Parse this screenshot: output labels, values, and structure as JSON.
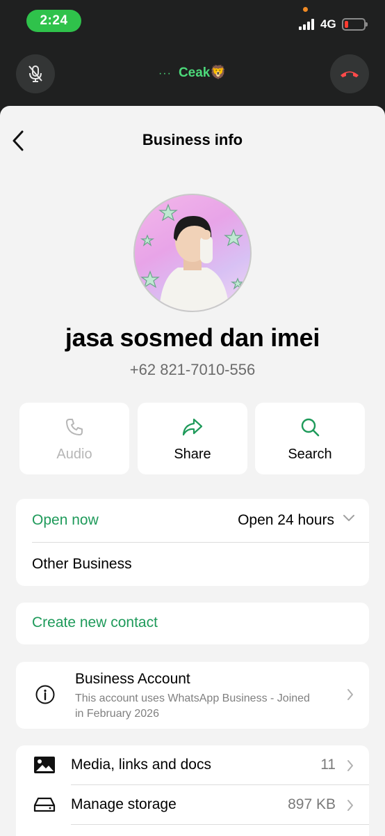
{
  "status_bar": {
    "time": "2:24",
    "network": "4G",
    "battery_level": 0.2,
    "time_pill_color": "#2fc24b"
  },
  "call_bar": {
    "dots": "···",
    "caller": "Ceak🦁",
    "mute_icon": "mic-off-icon",
    "end_icon": "phone-end-icon",
    "accent_color": "#4cd97a",
    "end_color": "#ff4a4a"
  },
  "header": {
    "title": "Business info",
    "back_icon": "chevron-left-icon"
  },
  "profile": {
    "name": "jasa sosmed dan imei",
    "phone": "+62 821-7010-556"
  },
  "actions": [
    {
      "label": "Audio",
      "icon": "phone-icon",
      "enabled": false
    },
    {
      "label": "Share",
      "icon": "share-arrow-icon",
      "enabled": true
    },
    {
      "label": "Search",
      "icon": "search-icon",
      "enabled": true
    }
  ],
  "hours": {
    "status": "Open now",
    "schedule": "Open 24 hours",
    "category": "Other Business"
  },
  "create_contact": {
    "label": "Create new contact"
  },
  "business_account": {
    "title": "Business Account",
    "description": "This account uses WhatsApp Business - Joined in February 2026",
    "icon": "info-icon"
  },
  "list": [
    {
      "label": "Media, links and docs",
      "value": "11",
      "icon": "image-icon"
    },
    {
      "label": "Manage storage",
      "value": "897 KB",
      "icon": "storage-icon"
    }
  ],
  "colors": {
    "green_accent": "#1e9a5a",
    "sheet_background": "#f3f3f3",
    "dark_background": "#1f2020"
  }
}
